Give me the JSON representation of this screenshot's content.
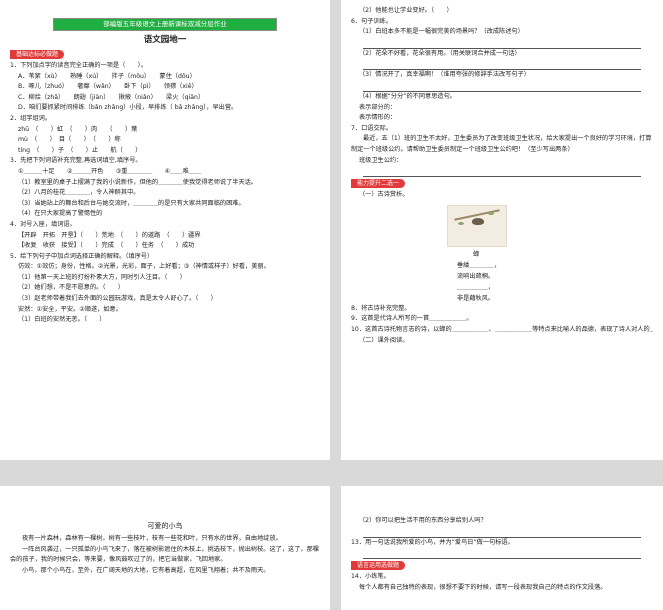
{
  "page1": {
    "banner": "部编版五年级语文上册新课标双减分层作业",
    "title": "语文园地一",
    "tag": "基础达标必做题",
    "lines": [
      "1．下列加点字的读音完全正确的一项是（　　）。",
      "A．苇絮（xù）　　熟睡（xú）　　拌子（mǒu）　　蒙住（dǒu）",
      "B．啄儿（zhuó）　　奢靡（wǎn）　　卧下（pì）　　领襟（xiě）",
      "C．柳烩（zhǎ）　　朗翅（jiàn）　　揪掖（niǎn）　　梁火（qiān）",
      "D．咱们要抓紧时间排练（bǎn zhǎng）小段，早排练（ bǎ zhǎng），早出营。",
      "2．组字组词。",
      "zhū　（　　）虹　（　　）肉　　（　　）葉",
      "mù　（　　）　目（　　）　（　　）称",
      "tíng　（　　）子　（　　）止　　航（　　）",
      "3．先把下列词语补充完整,再选词填空,填序号。",
      "①＿＿＿十足　　②＿＿＿开色　　③重＿＿＿＿　　④＿＿难＿＿",
      "（1）教室里的桌子上摆满了我的小说新作，但他的＿＿＿＿使我觉得老师说了半天话。",
      "（2）八月的桂花＿＿＿＿，令人神醉其中。",
      "（3）当她站上的舞台和后台与她交流时，＿＿＿＿的是只有大家共同面临的困难。",
      "（4）在只大家提高了警惕性的",
      "4．对号入座，填词语。",
      "【开辟　开拓　开垦】（　　）荒地　（　　）的道路　（　　）疆界",
      "【收复　收获　接受】（　　）完成　（　　）任务　（　　）成功",
      "5．给下列句子中加点词选择正确的解释。（填序号）",
      "仿效：①效仿；身份，性格。②光景，光彩，面子，上好看；③（神情或样子）好看，美丽。",
      "（1）他第一天上班的打扮朴素大方，同时引人注目。（　　）",
      "（2）她们想，不是不愿意的。（　　）",
      "（3）赵老师带着我们去外面的公园玩游戏，真是太令人舒心了。（　　）",
      "安然：①安全，平安。②顺遂，如意。",
      "（1）白班的安然无恙。（　　）"
    ]
  },
  "page2": {
    "lines_a": [
      "（2）他能也让学业变好。（　　）",
      "6．句子训练。",
      "（1）白班本多不能是一幅很完美的场景吗？（改成陈述句）"
    ],
    "lines_b": [
      "（2）花朵不好看，花朵很有用。（用关联词合并成一句话）"
    ],
    "lines_c": [
      "（3）情况开了，真幸福啊！（谁用夸张的修辞手法改写句子）"
    ],
    "lines_d": [
      "（4）根据“分分”的不同意思造句。",
      "表示部分的：",
      "表示情形的：",
      "7．口语交际。",
      "最近，五（1）班的卫生不太好，卫生委员为了改变班级卫生状况，给大家提出一个良好的学习环境，打算制定一个班级公约。请帮助卫生委员制定一个班级卫生公约吧！（至少写出两条）",
      "班级卫生公约："
    ],
    "tag2": "能力提升二选一",
    "sub": "（一）古诗赏析。",
    "poem_title": "蝉",
    "poem": [
      "垂緌＿＿＿＿，",
      "流响出疏桐。",
      "＿＿＿＿＿，",
      "非是藉秋风。"
    ],
    "lines_e": [
      "8．将古诗补充完整。",
      "9．这首是代诗人所写的一首＿＿＿＿＿＿。",
      "10．这首古诗托物言志的诗，以蝉的＿＿＿＿＿＿、＿＿＿＿＿＿等特点来比喻人的品德，表现了诗人对人的＿＿＿＿＿的高洁品质和＿＿＿＿＿＿。",
      "（二）课外阅读。"
    ]
  },
  "page3": {
    "title": "可爱的小鸟",
    "paras": [
      "夜有一片森林，森林有一棵树，树有一些枝叶，枝有一些花和叶，只有水的世界，自由地绽放。",
      "一阵台风袭过，一只孤单的小鸟飞来了，落在被树影遮住的木枝上，挑选枝下，抛出树枝。这了，这了，那棵会的孩子，我的时候只会，等来要，像风鼓吹过了的，把它当做家，飞回地家。",
      "小鸟，那个小鸟在，至外，在广阔天地的大地，它有着高超，在风里飞翔着；共不及雨天。"
    ]
  },
  "page4": {
    "lines_a": [
      "（2）你可以把生活不用的东西分享给别人吗？"
    ],
    "lines_b": [
      "13．用一句话说我所爱的小鸟，并为“爱鸟日”做一句标语。"
    ],
    "tag3": "语言运用选做题",
    "lines_c": [
      "14．小练笔。",
      "每个人都有自己独特的表现，很想不要下的时候，请写一段表现我自己的特点的作文段落。"
    ]
  }
}
